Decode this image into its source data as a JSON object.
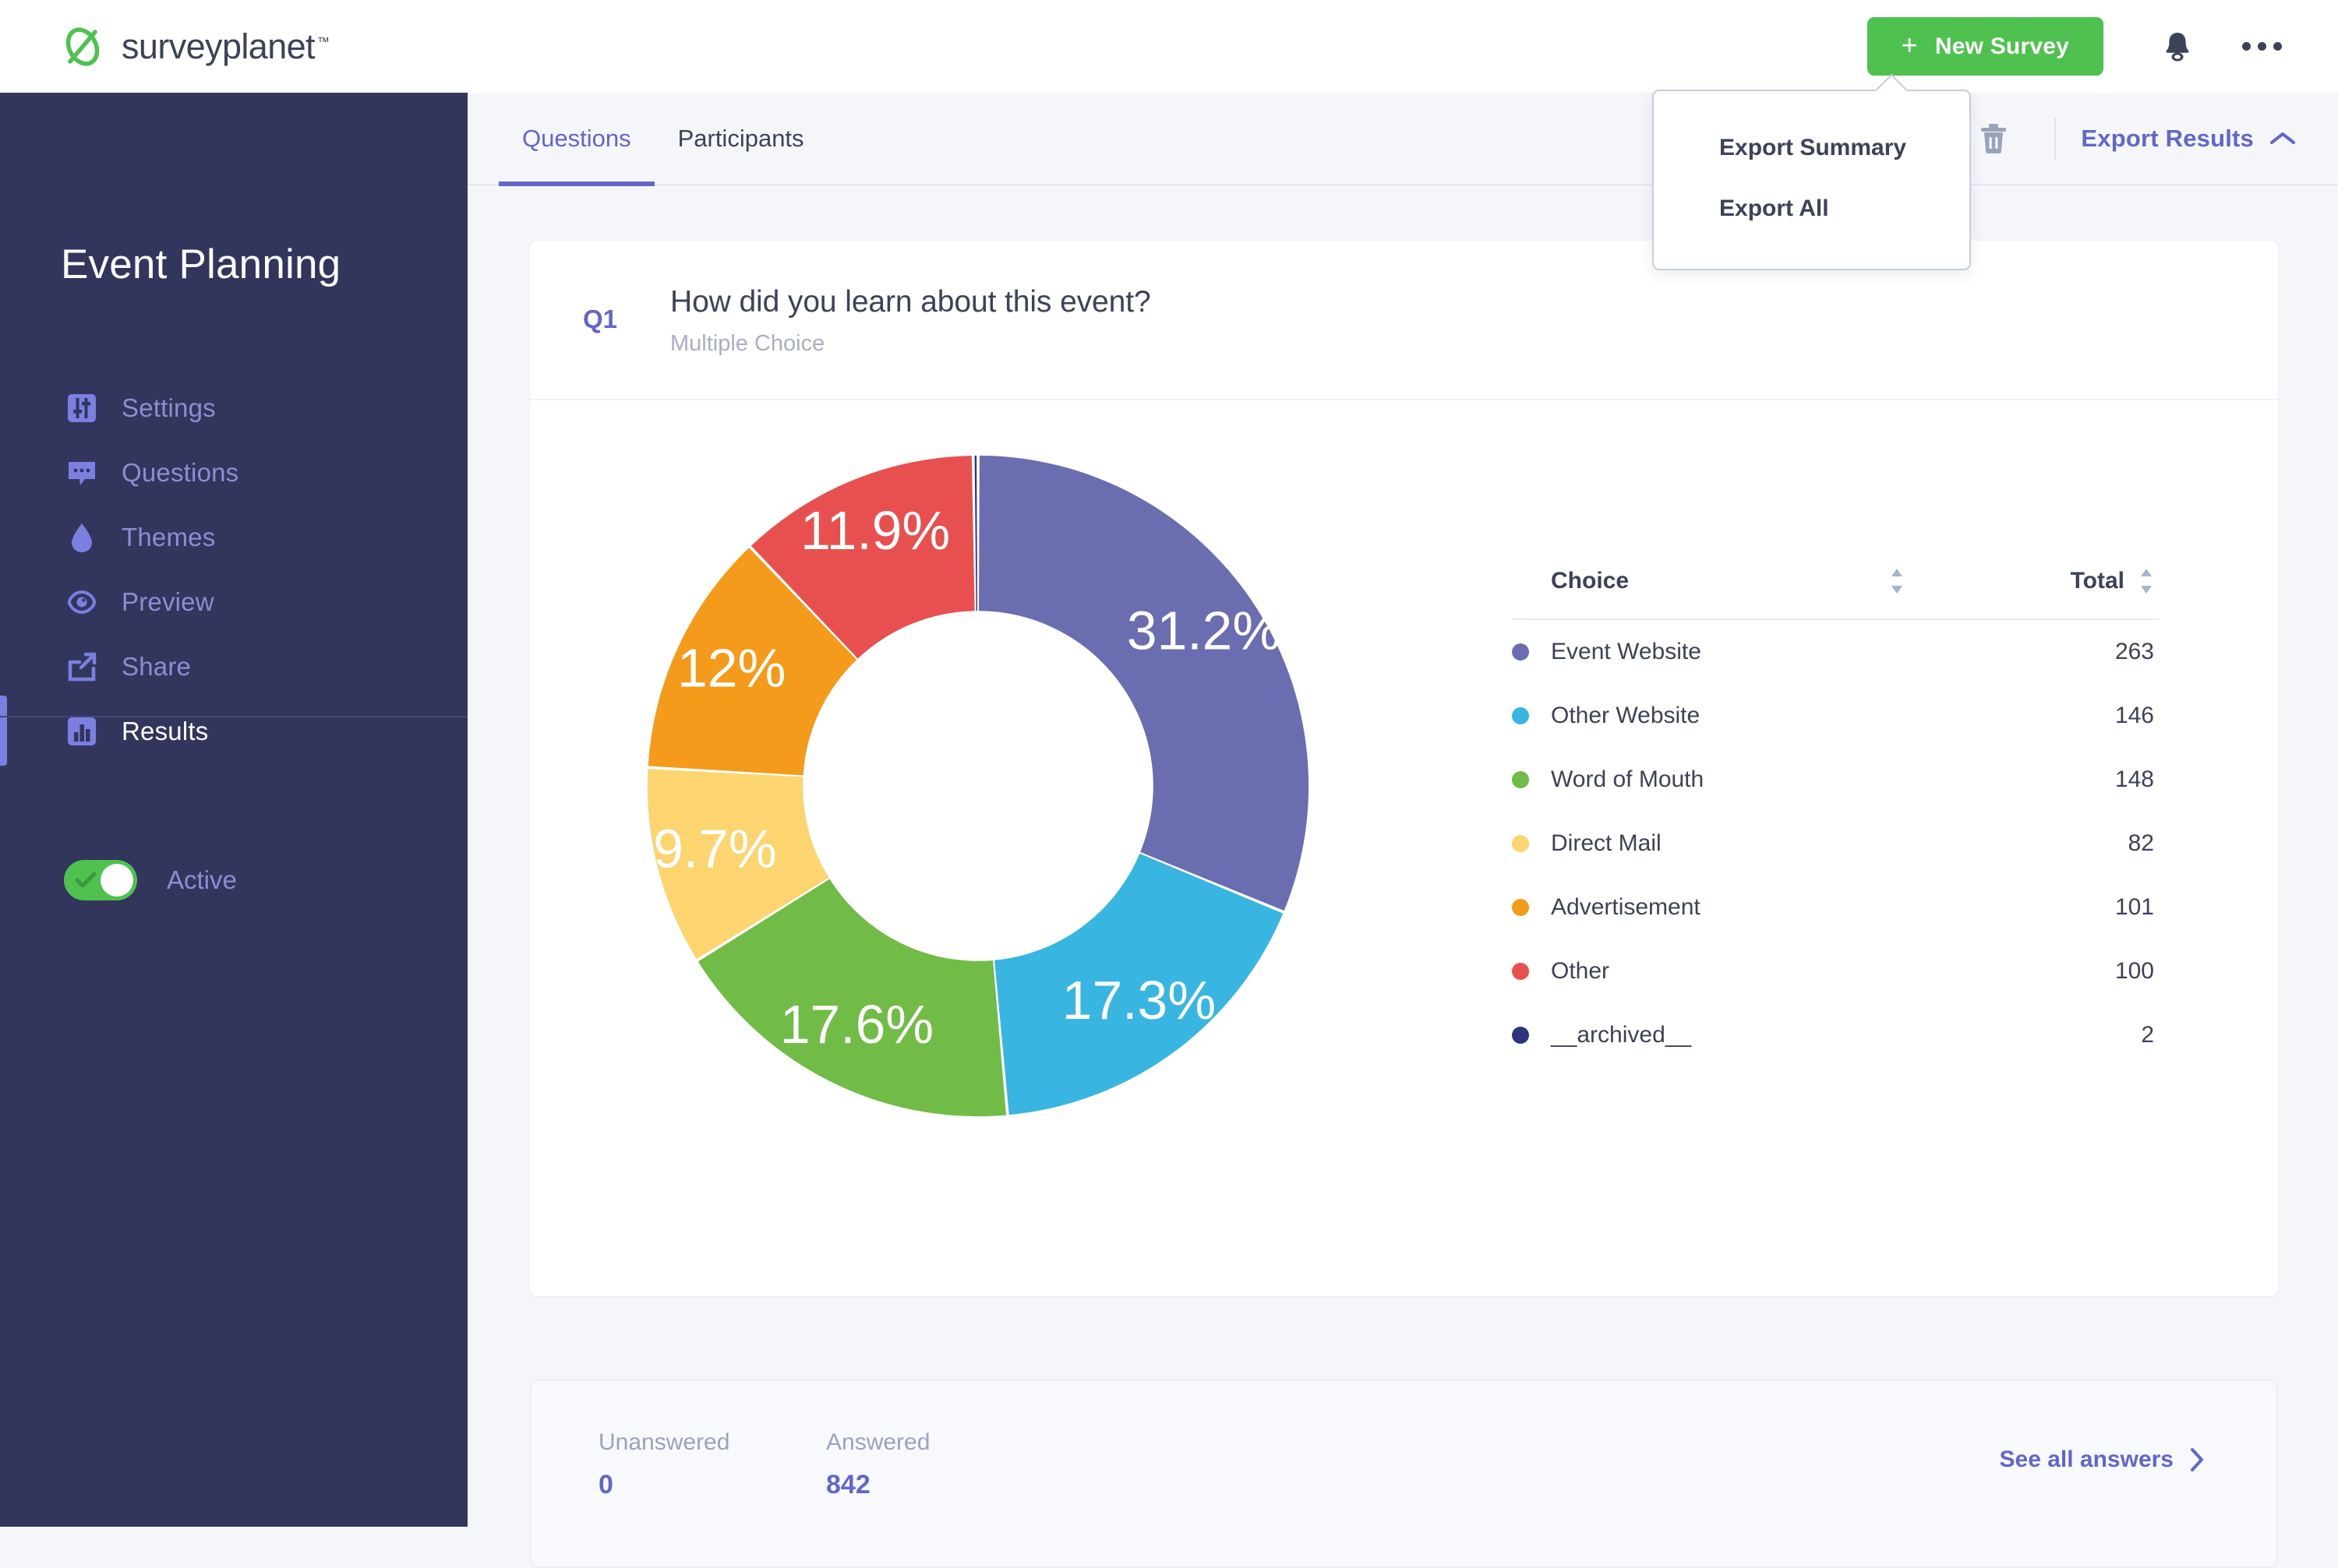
{
  "topbar": {
    "brand_name": "surveyplanet",
    "brand_tm": "™",
    "new_survey_label": "New Survey",
    "plus_glyph": "+",
    "bell_icon": "bell-icon",
    "more_icon": "more-horizontal-icon"
  },
  "sidebar": {
    "title": "Event Planning",
    "items": [
      {
        "label": "Settings",
        "icon": "sliders-icon",
        "active": false
      },
      {
        "label": "Questions",
        "icon": "chat-icon",
        "active": false
      },
      {
        "label": "Themes",
        "icon": "droplet-icon",
        "active": false
      },
      {
        "label": "Preview",
        "icon": "eye-icon",
        "active": false
      },
      {
        "label": "Share",
        "icon": "share-icon",
        "active": false
      },
      {
        "label": "Results",
        "icon": "bar-chart-icon",
        "active": true
      }
    ],
    "toggle": {
      "label": "Active",
      "state": "on"
    }
  },
  "tabs": [
    {
      "label": "Questions",
      "active": true
    },
    {
      "label": "Participants",
      "active": false
    }
  ],
  "toolbar": {
    "trash_icon": "trash-icon",
    "export_label": "Export Results",
    "export_chevron": "chevron-up-icon"
  },
  "dropdown": {
    "open": true,
    "items": [
      {
        "label": "Export Summary"
      },
      {
        "label": "Export All"
      }
    ]
  },
  "question": {
    "number": "Q1",
    "text": "How did you learn about this event?",
    "type": "Multiple Choice"
  },
  "table": {
    "headers": {
      "choice": "Choice",
      "total": "Total"
    },
    "rows": [
      {
        "choice": "Event Website",
        "total": "263",
        "color": "#6a6eb0"
      },
      {
        "choice": "Other Website",
        "total": "146",
        "color": "#38b5e0"
      },
      {
        "choice": "Word of Mouth",
        "total": "148",
        "color": "#70bc46"
      },
      {
        "choice": "Direct Mail",
        "total": "82",
        "color": "#fcd571"
      },
      {
        "choice": "Advertisement",
        "total": "101",
        "color": "#f49b1c"
      },
      {
        "choice": "Other",
        "total": "100",
        "color": "#e8504f"
      },
      {
        "choice": "__archived__",
        "total": "2",
        "color": "#2e3380"
      }
    ]
  },
  "stats": {
    "unanswered_label": "Unanswered",
    "unanswered_value": "0",
    "answered_label": "Answered",
    "answered_value": "842",
    "see_all_label": "See all answers",
    "see_all_chevron": "chevron-right-icon"
  },
  "chart_data": {
    "type": "pie",
    "variant": "donut",
    "title": "How did you learn about this event?",
    "legend_position": "right",
    "inner_radius_ratio": 0.53,
    "start_angle_deg": -90,
    "direction": "clockwise",
    "total": 842,
    "categories": [
      "Event Website",
      "Other Website",
      "Word of Mouth",
      "Direct Mail",
      "Advertisement",
      "Other",
      "__archived__"
    ],
    "values": [
      263,
      146,
      148,
      82,
      101,
      100,
      2
    ],
    "percent_labels": [
      "31.2%",
      "17.3%",
      "17.6%",
      "9.7%",
      "12%",
      "11.9%",
      ""
    ],
    "percents": [
      31.2,
      17.3,
      17.6,
      9.7,
      12.0,
      11.9,
      0.24
    ],
    "colors": [
      "#6a6eb0",
      "#38b5e0",
      "#70bc46",
      "#fcd571",
      "#f49b1c",
      "#e8504f",
      "#2e3380"
    ],
    "labels_shown": [
      true,
      true,
      true,
      true,
      true,
      true,
      false
    ]
  },
  "theme": {
    "brand_green": "#4ec14e",
    "sidebar_bg": "#32355c",
    "accent_purple": "#6366c9",
    "text_dark": "#3c4257",
    "page_bg": "#f4f6fa"
  }
}
